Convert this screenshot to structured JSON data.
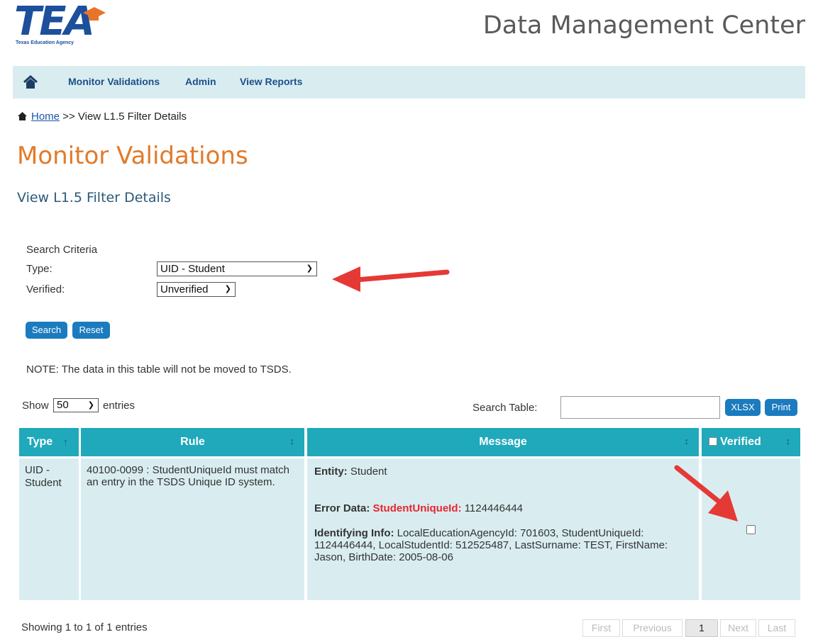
{
  "header": {
    "logo_text": "TEA",
    "logo_subtitle": "Texas Education Agency",
    "app_title": "Data Management Center"
  },
  "nav": {
    "items": [
      "Monitor Validations",
      "Admin",
      "View Reports"
    ]
  },
  "breadcrumb": {
    "home": "Home",
    "separator": ">>",
    "current": "View L1.5 Filter Details"
  },
  "page": {
    "title": "Monitor Validations",
    "subtitle": "View L1.5 Filter Details"
  },
  "search_criteria": {
    "heading": "Search Criteria",
    "type_label": "Type:",
    "type_value": "UID - Student",
    "verified_label": "Verified:",
    "verified_value": "Unverified",
    "search_button": "Search",
    "reset_button": "Reset"
  },
  "note": "NOTE: The data in this table will not be moved to TSDS.",
  "table_controls": {
    "show_label": "Show",
    "entries_value": "50",
    "entries_label": "entries",
    "search_label": "Search Table:",
    "xlsx_button": "XLSX",
    "print_button": "Print"
  },
  "table": {
    "columns": [
      "Type",
      "Rule",
      "Message",
      "Verified"
    ],
    "rows": [
      {
        "type": "UID - Student",
        "rule": "40100-0099 : StudentUniqueId must match an entry in the TSDS Unique ID system.",
        "entity_label": "Entity:",
        "entity_value": "Student",
        "error_label": "Error Data:",
        "error_field": "StudentUniqueId:",
        "error_value": "1124446444",
        "ident_label": "Identifying Info:",
        "ident_value": "LocalEducationAgencyId: 701603, StudentUniqueId: 1124446444, LocalStudentId: 512525487, LastSurname: TEST, FirstName: Jason, BirthDate: 2005-08-06"
      }
    ]
  },
  "footer": {
    "info": "Showing 1 to 1 of 1 entries",
    "pager": [
      "First",
      "Previous",
      "1",
      "Next",
      "Last"
    ]
  },
  "colors": {
    "accent_orange": "#e27a2a",
    "table_header": "#1fa9bb",
    "row_bg": "#d9edf1",
    "error_red": "#e8262c",
    "annotation_arrow": "#e53935"
  }
}
